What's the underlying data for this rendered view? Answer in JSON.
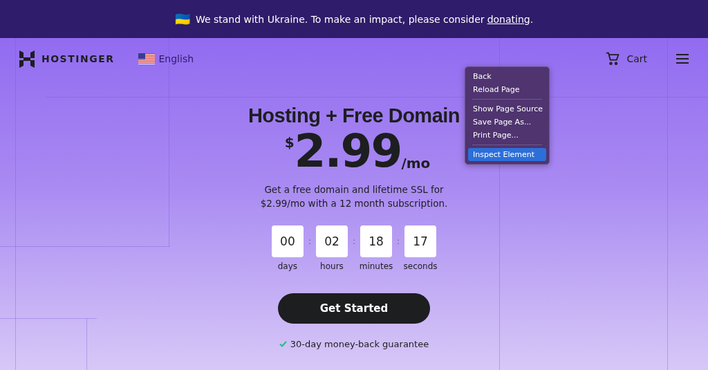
{
  "banner": {
    "flag": "🇺🇦",
    "text": "We stand with Ukraine. To make an impact, please consider",
    "link": "donating",
    "end": "."
  },
  "header": {
    "logo": "HOSTINGER",
    "language": "English",
    "cart": "Cart"
  },
  "hero": {
    "title": "Hosting + Free Domain",
    "currency": "$",
    "price": "2.99",
    "period": "/mo",
    "description": "Get a free domain and lifetime SSL for $2.99/mo with a 12 month subscription.",
    "countdown": [
      {
        "value": "00",
        "unit": "days"
      },
      {
        "value": "02",
        "unit": "hours"
      },
      {
        "value": "18",
        "unit": "minutes"
      },
      {
        "value": "17",
        "unit": "seconds"
      }
    ],
    "separator": ":",
    "cta": "Get Started",
    "guarantee": "30-day money-back guarantee"
  },
  "context_menu": {
    "groups": [
      [
        {
          "label": "Back",
          "selected": false
        },
        {
          "label": "Reload Page",
          "selected": false
        }
      ],
      [
        {
          "label": "Show Page Source",
          "selected": false
        },
        {
          "label": "Save Page As...",
          "selected": false
        },
        {
          "label": "Print Page...",
          "selected": false
        }
      ],
      [
        {
          "label": "Inspect Element",
          "selected": true
        }
      ]
    ]
  }
}
